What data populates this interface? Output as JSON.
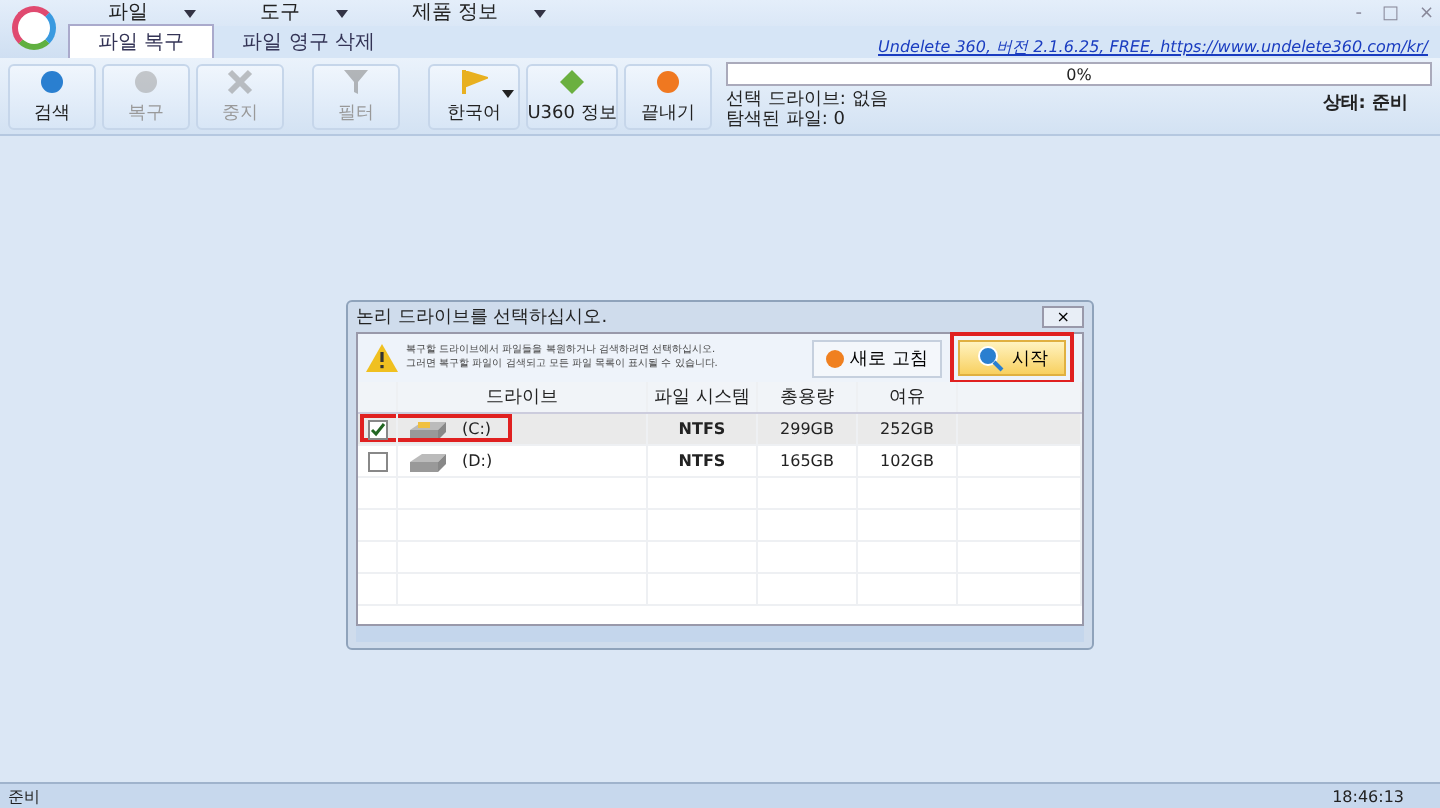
{
  "menu": [
    "파일",
    "도구",
    "제품 정보"
  ],
  "tabs": [
    {
      "label": "파일 복구",
      "selected": true
    },
    {
      "label": "파일 영구 삭제",
      "selected": false
    }
  ],
  "window_controls": [
    "-",
    "□",
    "×"
  ],
  "link": "Undelete 360, 버전 2.1.6.25, FREE, https://www.undelete360.com/kr/",
  "toolbar": [
    {
      "label": "검색",
      "kind": "search",
      "disabled": false
    },
    {
      "label": "복구",
      "kind": "restore",
      "disabled": true
    },
    {
      "label": "중지",
      "kind": "stop",
      "disabled": true
    },
    {
      "label": "필터",
      "kind": "filter",
      "disabled": true
    },
    {
      "label": "한국어",
      "kind": "language",
      "disabled": false
    },
    {
      "label": "U360 정보",
      "kind": "info",
      "disabled": false
    },
    {
      "label": "끝내기",
      "kind": "exit",
      "disabled": false
    }
  ],
  "progress": {
    "level": 0,
    "reading": "0%"
  },
  "selected_drive": "선택 드라이브: 없음",
  "found_files": "탐색된 파일: 0",
  "state": "상태: 준비",
  "dialog": {
    "title": "논리 드라이브를 선택하십시오.",
    "close": "×",
    "warning": [
      "복구할 드라이브에서 파일들을 복원하거나 검색하려면 선택하십시오.",
      "그러면 복구할 파일이 검색되고 모든 파일 목록이 표시될 수 있습니다."
    ],
    "refresh": "새로 고침",
    "start": "시작",
    "columns": [
      "드라이브",
      "파일 시스템",
      "총용량",
      "여유"
    ],
    "rows": [
      {
        "drive": "(C:)",
        "fs": "NTFS",
        "total": "299GB",
        "free": "252GB",
        "checked": true,
        "selected": true
      },
      {
        "drive": "(D:)",
        "fs": "NTFS",
        "total": "165GB",
        "free": "102GB",
        "checked": false,
        "selected": false
      }
    ]
  },
  "status": {
    "text": "준비",
    "time": "18:46:13"
  }
}
